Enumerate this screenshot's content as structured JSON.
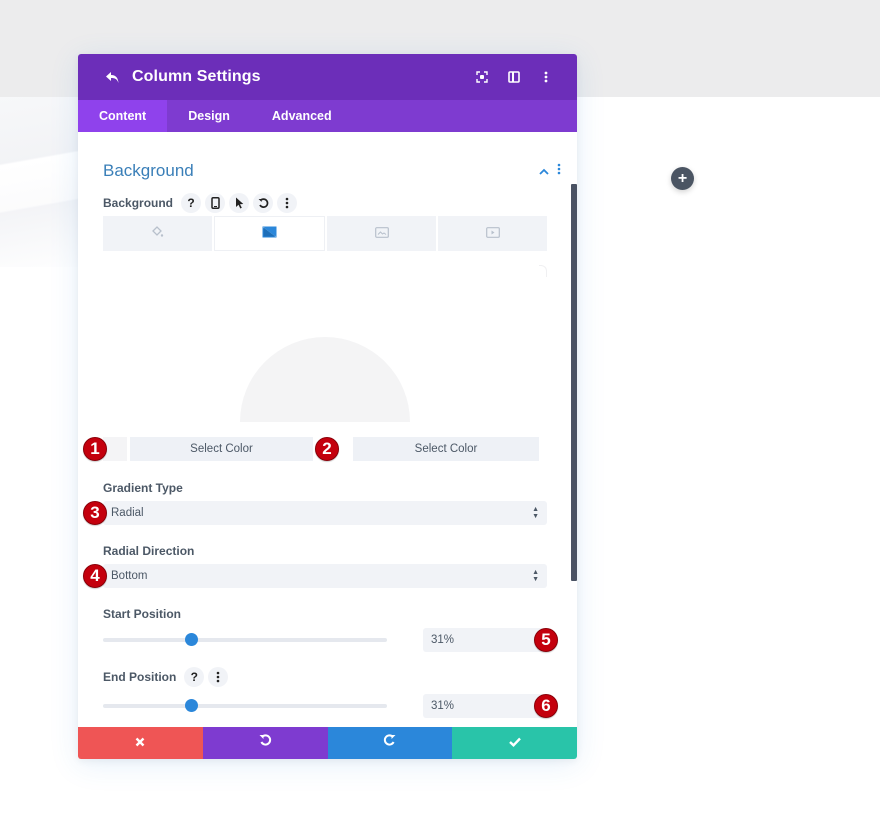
{
  "modal": {
    "title": "Column Settings",
    "header_icons": [
      "back-icon",
      "focus-mode-icon",
      "split-view-icon",
      "more-options-icon"
    ],
    "tabs": [
      {
        "label": "Content",
        "active": true
      },
      {
        "label": "Design",
        "active": false
      },
      {
        "label": "Advanced",
        "active": false
      }
    ]
  },
  "section": {
    "title": "Background",
    "toggle_icon": "chevron-up-icon"
  },
  "background_field": {
    "label": "Background",
    "help_glyph": "?",
    "type_tabs": [
      {
        "name": "color",
        "icon": "paint-bucket-icon",
        "active": false
      },
      {
        "name": "gradient",
        "icon": "gradient-icon",
        "active": true
      },
      {
        "name": "image",
        "icon": "image-icon",
        "active": false
      },
      {
        "name": "video",
        "icon": "video-icon",
        "active": false
      }
    ]
  },
  "gradient": {
    "color_stops": [
      {
        "label": "Select Color",
        "badge": "1"
      },
      {
        "label": "Select Color",
        "badge": "2"
      }
    ],
    "type_label": "Gradient Type",
    "type_value": "Radial",
    "type_badge": "3",
    "direction_label": "Radial Direction",
    "direction_value": "Bottom",
    "direction_badge": "4",
    "start_label": "Start Position",
    "start_value": "31%",
    "start_percent": 31,
    "start_badge": "5",
    "end_label": "End Position",
    "end_value": "31%",
    "end_percent": 31,
    "end_badge": "6",
    "end_help_glyph": "?"
  },
  "footer": {
    "buttons": [
      {
        "name": "cancel",
        "color": "#ef5555"
      },
      {
        "name": "undo",
        "color": "#7e3bd0"
      },
      {
        "name": "redo",
        "color": "#2b87da"
      },
      {
        "name": "save",
        "color": "#29c4a9"
      }
    ]
  },
  "colors": {
    "header": "#6c2eb9",
    "tabs": "#7e3bd0",
    "active_tab": "#8f42ec",
    "accent": "#2b87da",
    "badge": "#c4000d"
  }
}
